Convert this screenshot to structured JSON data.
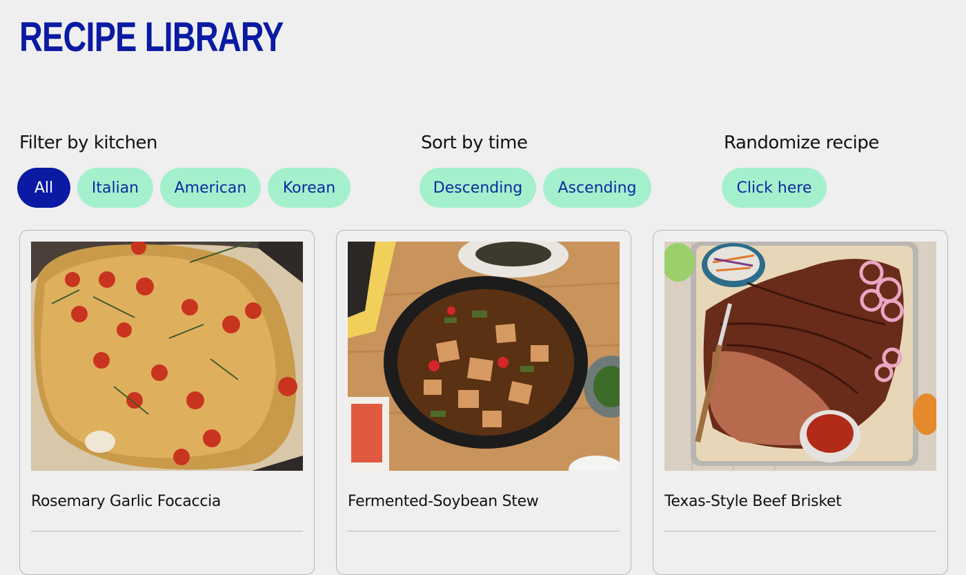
{
  "header": {
    "title": "RECIPE LIBRARY"
  },
  "filters": {
    "kitchen": {
      "label": "Filter by kitchen",
      "options": [
        "All",
        "Italian",
        "American",
        "Korean"
      ],
      "selected": "All"
    },
    "time": {
      "label": "Sort by time",
      "options": [
        "Descending",
        "Ascending"
      ]
    },
    "random": {
      "label": "Randomize recipe",
      "button": "Click here"
    }
  },
  "recipes": [
    {
      "title": "Rosemary Garlic Focaccia",
      "image": "focaccia-image"
    },
    {
      "title": "Fermented-Soybean Stew",
      "image": "stew-image"
    },
    {
      "title": "Texas-Style Beef Brisket",
      "image": "brisket-image"
    }
  ],
  "colors": {
    "accent": "#0a1aa3",
    "chip": "#a5f0cc",
    "background": "#efefef"
  }
}
